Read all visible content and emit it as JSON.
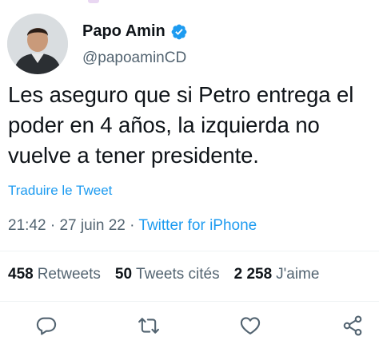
{
  "author": {
    "display_name": "Papo Amin",
    "handle": "@papoaminCD",
    "verified_icon": "verified-badge-icon",
    "badge_color": "#1d9bf0"
  },
  "tweet": {
    "text": "Les aseguro que si Petro entrega el poder en 4 años, la izquierda no vuelve a tener presidente.",
    "translate_link": "Traduire le Tweet"
  },
  "meta": {
    "time": "21:42",
    "separator": "·",
    "date": "27 juin 22",
    "source": "Twitter for iPhone"
  },
  "stats": {
    "retweets_count": "458",
    "retweets_label": "Retweets",
    "quotes_count": "50",
    "quotes_label": "Tweets cités",
    "likes_count": "2 258",
    "likes_label": "J'aime"
  },
  "actions": {
    "reply_icon": "reply-icon",
    "retweet_icon": "retweet-icon",
    "like_icon": "heart-icon",
    "share_icon": "share-icon"
  },
  "colors": {
    "text": "#0f1419",
    "secondary": "#536471",
    "accent": "#1d9bf0",
    "divider": "#eff3f4"
  }
}
